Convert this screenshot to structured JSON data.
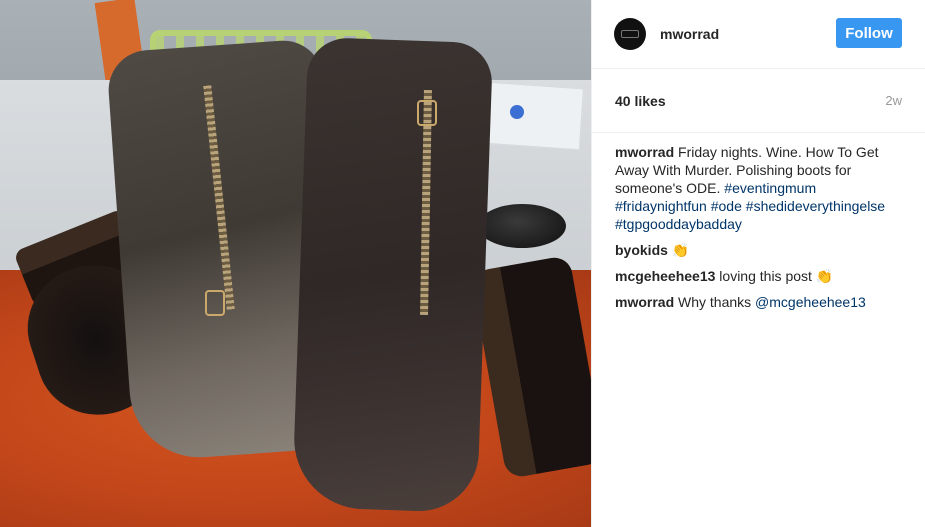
{
  "post": {
    "username": "mworrad",
    "follow_label": "Follow",
    "likes": "40 likes",
    "age": "2w",
    "caption": {
      "author": "mworrad",
      "text": "Friday nights. Wine. How To Get Away With Murder. Polishing boots for someone's ODE.",
      "hashtags": [
        "#eventingmum",
        "#fridaynightfun",
        "#ode",
        "#shedideverythingelse",
        "#tgpgooddaybadday"
      ]
    },
    "comments": [
      {
        "author": "byokids",
        "text": "",
        "emoji": "👏"
      },
      {
        "author": "mcgeheehee13",
        "text": "loving this post",
        "emoji": "👏"
      },
      {
        "author": "mworrad",
        "text": "Why thanks",
        "mention": "@mcgeheehee13"
      }
    ]
  },
  "colors": {
    "follow_button": "#3897f0",
    "hashtag": "#003569",
    "muted": "#999999"
  },
  "icons": {
    "avatar": "profile-avatar"
  }
}
